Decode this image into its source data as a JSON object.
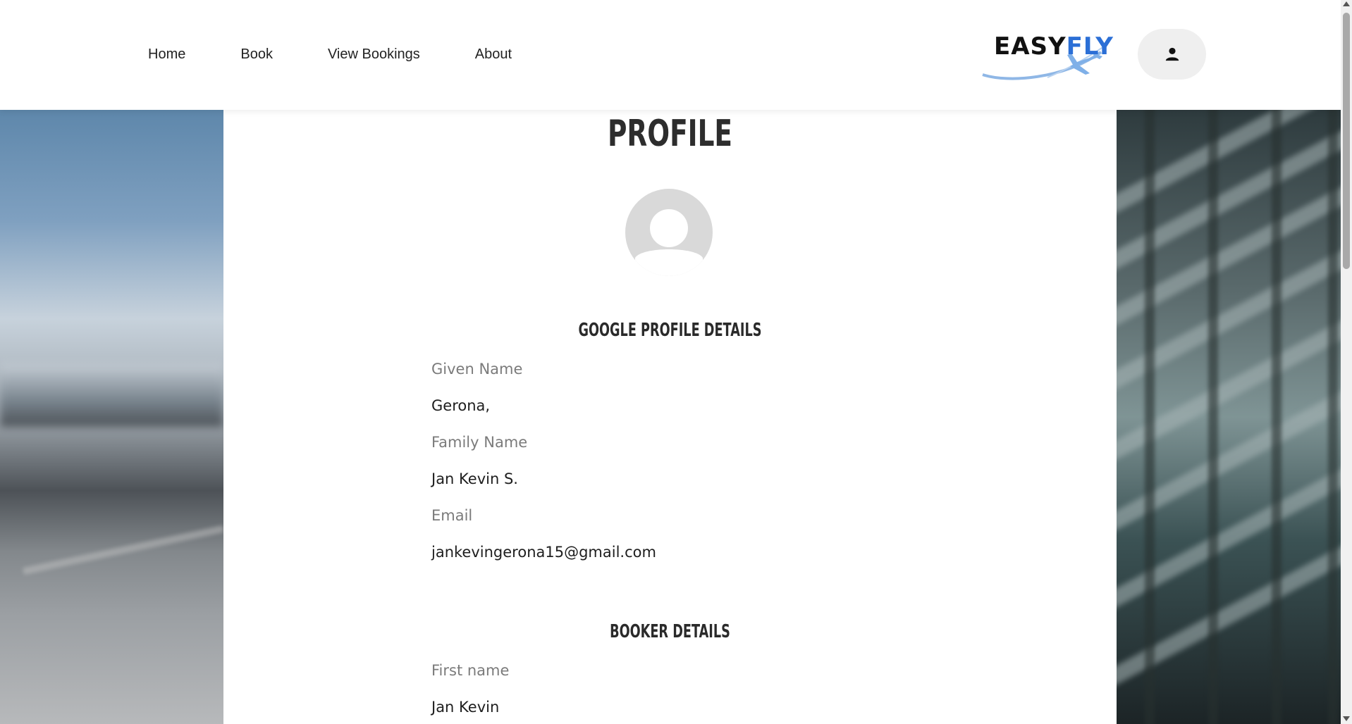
{
  "nav": {
    "items": [
      {
        "label": "Home"
      },
      {
        "label": "Book"
      },
      {
        "label": "View Bookings"
      },
      {
        "label": "About"
      }
    ]
  },
  "logo": {
    "part1": "EASY",
    "part2": "FLY"
  },
  "user_menu": {
    "icon": "user-icon"
  },
  "page": {
    "title": "PROFILE"
  },
  "google_profile": {
    "heading": "GOOGLE PROFILE DETAILS",
    "fields": [
      {
        "label": "Given Name",
        "value": "Gerona,"
      },
      {
        "label": "Family Name",
        "value": "Jan Kevin S."
      },
      {
        "label": "Email",
        "value": "jankevingerona15@gmail.com"
      }
    ]
  },
  "booker": {
    "heading": "BOOKER DETAILS",
    "fields": [
      {
        "label": "First name",
        "value": "Jan Kevin"
      }
    ]
  },
  "colors": {
    "accent": "#2b6fd6",
    "avatar_bg": "#d9d9d9"
  }
}
